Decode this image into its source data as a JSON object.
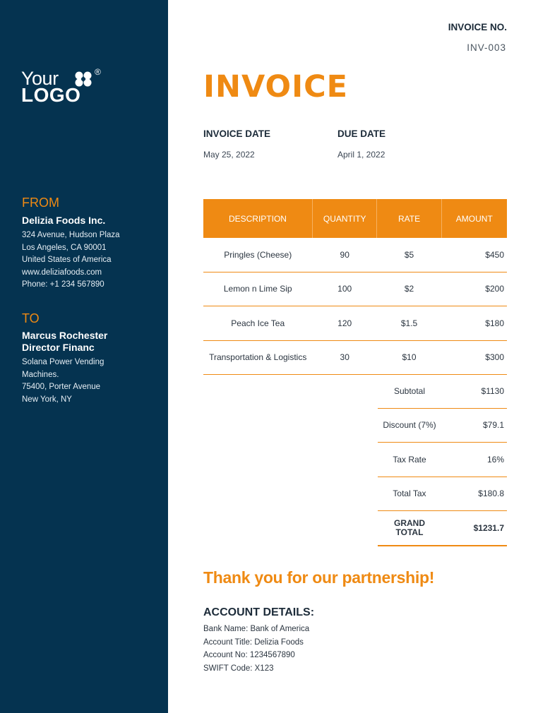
{
  "logo": {
    "line1": "Your",
    "line2": "LOGO",
    "reg": "®"
  },
  "invoice_no": {
    "label": "INVOICE NO.",
    "value": "INV-003"
  },
  "title": "INVOICE",
  "invoice_date": {
    "label": "INVOICE DATE",
    "value": "May 25, 2022"
  },
  "due_date": {
    "label": "DUE DATE",
    "value": "April 1, 2022"
  },
  "from": {
    "label": "FROM",
    "name": "Delizia Foods Inc.",
    "lines": [
      "324 Avenue, Hudson Plaza",
      "Los Angeles, CA 90001",
      "United States of America",
      "www.deliziafoods.com",
      "Phone: +1 234 567890"
    ]
  },
  "to": {
    "label": "TO",
    "name_line1": "Marcus Rochester",
    "name_line2": "Director Financ",
    "lines": [
      "Solana Power Vending",
      "Machines.",
      "75400, Porter Avenue",
      "New York, NY"
    ]
  },
  "table": {
    "headers": [
      "DESCRIPTION",
      "QUANTITY",
      "RATE",
      "AMOUNT"
    ],
    "rows": [
      [
        "Pringles (Cheese)",
        "90",
        "$5",
        "$450"
      ],
      [
        "Lemon n Lime Sip",
        "100",
        "$2",
        "$200"
      ],
      [
        "Peach Ice Tea",
        "120",
        "$1.5",
        "$180"
      ],
      [
        "Transportation & Logistics",
        "30",
        "$10",
        "$300"
      ]
    ]
  },
  "totals": [
    {
      "label": "Subtotal",
      "value": "$1130"
    },
    {
      "label": "Discount (7%)",
      "value": "$79.1"
    },
    {
      "label": "Tax Rate",
      "value": "16%"
    },
    {
      "label": "Total Tax",
      "value": "$180.8"
    }
  ],
  "grand_total": {
    "label_line1": "GRAND",
    "label_line2": "TOTAL",
    "value": "$1231.7"
  },
  "thanks": "Thank you for our partnership!",
  "account": {
    "title": "ACCOUNT DETAILS:",
    "lines": [
      "Bank Name: Bank of America",
      "Account Title: Delizia Foods",
      "Account No: 1234567890",
      "SWIFT Code: X123"
    ]
  },
  "colors": {
    "sidebar": "#053350",
    "accent": "#ef8a13"
  }
}
